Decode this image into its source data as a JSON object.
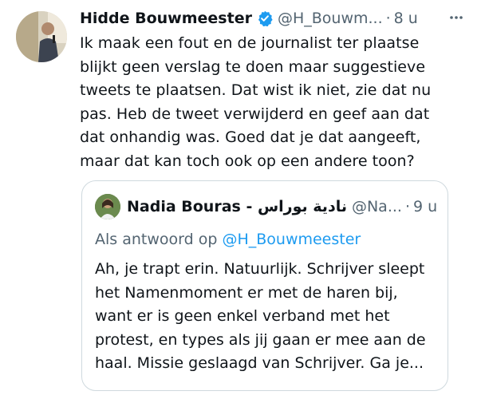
{
  "tweet": {
    "name": "Hidde Bouwmeester",
    "handle": "@H_Bouwm...",
    "dot": "·",
    "time": "8 u",
    "text": "Ik maak een fout en de journalist ter plaatse blijkt geen verslag te doen maar suggestieve tweets te plaatsen. Dat wist ik niet, zie dat nu pas. Heb de tweet verwijderd en geef aan dat dat onhandig was. Goed dat je dat aangeeft, maar dat kan toch ook op een andere toon?"
  },
  "quote": {
    "name": "Nadia Bouras - نادية بوراس",
    "handle": "@Na...",
    "dot": "·",
    "time": "9 u",
    "reply_prefix": "Als antwoord op",
    "reply_mention": "@H_Bouwmeester",
    "text": "Ah, je trapt erin. Natuurlijk. Schrijver sleept het Namenmoment er met de haren bij, want er is geen enkel verband met het protest, en types als jij gaan er mee aan de haal. Missie geslaagd van Schrijver. Ga je..."
  },
  "colors": {
    "text": "#0f1419",
    "secondary": "#536471",
    "link": "#1d9bf0",
    "verified": "#1d9bf0",
    "border": "#cfd9de"
  },
  "icons": {
    "verified": "verified-badge-icon",
    "more": "more-options-icon"
  }
}
